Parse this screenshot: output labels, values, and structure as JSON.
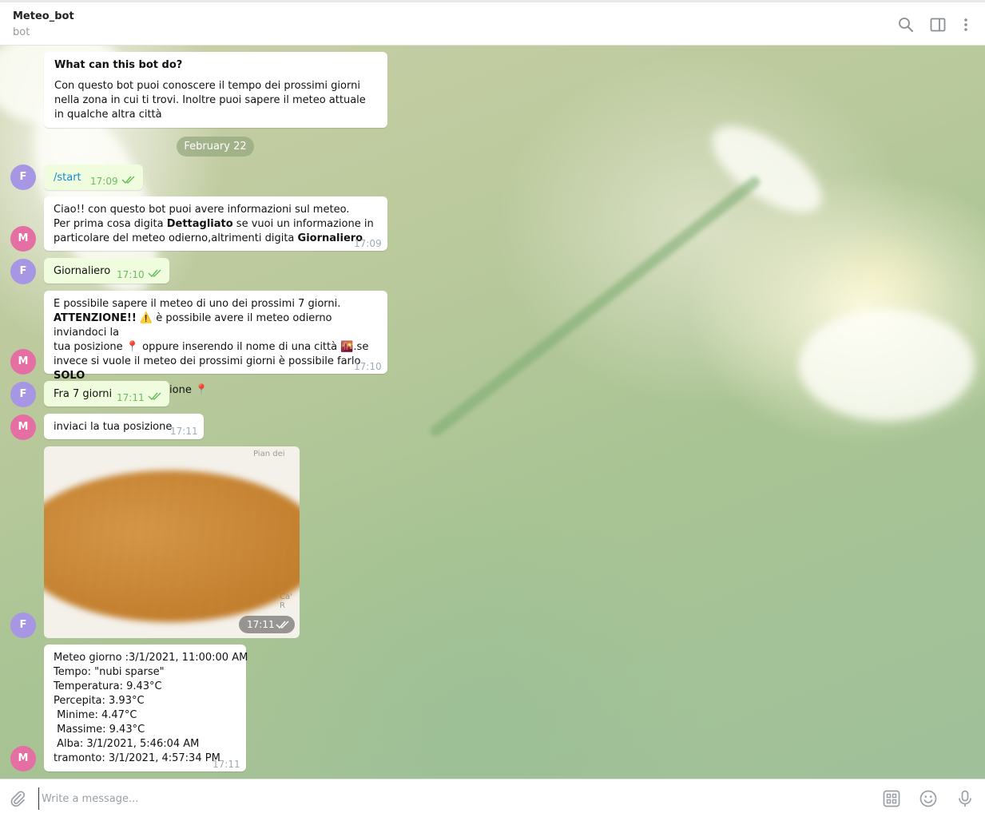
{
  "header": {
    "title": "Meteo_bot",
    "subtitle": "bot",
    "icons": [
      "search-icon",
      "sidebar-toggle-icon",
      "more-vertical-icon"
    ]
  },
  "intro": {
    "title": "What can this bot do?",
    "text": "Con questo bot puoi conoscere il tempo dei prossimi giorni nella zona in cui ti trovi. Inoltre puoi sapere il meteo attuale in qualche altra città"
  },
  "date_separator": "February 22",
  "avatars": {
    "user_initial": "F",
    "bot_initial": "M"
  },
  "messages": {
    "m1": {
      "text": "/start",
      "time": "17:09"
    },
    "m2": {
      "line1": "Ciao!! con questo bot puoi avere informazioni sul meteo.",
      "line2_a": "Per prima cosa digita ",
      "line2_b": "Dettagliato",
      "line2_c": " se vuoi un informazione in",
      "line3_a": "particolare del meteo odierno,altrimenti digita ",
      "line3_b": "Giornaliero",
      "time": "17:09"
    },
    "m3": {
      "text": "Giornaliero",
      "time": "17:10"
    },
    "m4": {
      "line1": "E possibile sapere il meteo di uno dei prossimi 7 giorni.",
      "line2_a": "ATTENZIONE!!",
      "line2_b": " è possibile avere il meteo odierno inviandoci la",
      "line3_a": "tua posizione ",
      "line3_b": " oppure inserendo il nome di una città ",
      "line3_c": ".se",
      "line4_a": "invece si vuole il meteo dei prossimi giorni è possibile farlo ",
      "line4_b": "SOLO",
      "line5": "inviandoci la tua posizione ",
      "time": "17:10"
    },
    "m5": {
      "text": "Fra 7 giorni",
      "time": "17:11"
    },
    "m6": {
      "text": "inviaci la tua posizione",
      "time": "17:11"
    },
    "m7": {
      "map_label_top": "Pian dei",
      "map_label_side": "Ca' R",
      "time": "17:11"
    },
    "m8": {
      "lines": [
        "Meteo giorno :3/1/2021, 11:00:00 AM",
        "Tempo: \"nubi sparse\"",
        "Temperatura: 9.43°C",
        "Percepita: 3.93°C",
        " Minime: 4.47°C",
        " Massime: 9.43°C",
        " Alba: 3/1/2021, 5:46:04 AM",
        "tramonto: 3/1/2021, 4:57:34 PM"
      ],
      "time": "17:11"
    }
  },
  "composer": {
    "placeholder": "Write a message...",
    "icons": [
      "attach-icon",
      "bot-commands-icon",
      "emoji-icon",
      "microphone-icon"
    ]
  },
  "colors": {
    "outgoing_bubble": "#effdde",
    "incoming_bubble": "#ffffff",
    "outgoing_time": "#6cbb5e",
    "link": "#168acd",
    "avatar_user": "#a796e3",
    "avatar_bot": "#e56fa2"
  }
}
